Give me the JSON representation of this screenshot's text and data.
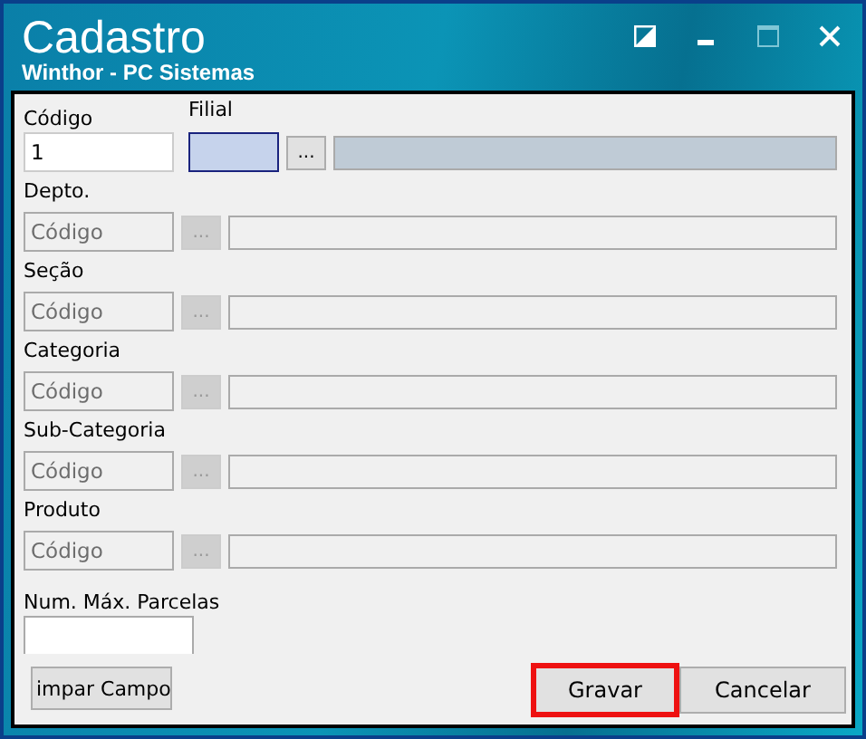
{
  "window": {
    "title": "Cadastro",
    "subtitle": "Winthor - PC Sistemas"
  },
  "codigo": {
    "label": "Código",
    "value": "1"
  },
  "filial": {
    "label": "Filial",
    "button": "...",
    "focused": true
  },
  "lookups": [
    {
      "label": "Depto.",
      "placeholder": "Código",
      "button": "...",
      "disabled": true
    },
    {
      "label": "Seção",
      "placeholder": "Código",
      "button": "...",
      "disabled": true
    },
    {
      "label": "Categoria",
      "placeholder": "Código",
      "button": "...",
      "disabled": true
    },
    {
      "label": "Sub-Categoria",
      "placeholder": "Código",
      "button": "...",
      "disabled": true
    },
    {
      "label": "Produto",
      "placeholder": "Código",
      "button": "...",
      "disabled": true
    }
  ],
  "parcelas": {
    "label": "Num. Máx. Parcelas"
  },
  "buttons": [
    {
      "label": "impar Campo",
      "kind": "clear",
      "highlighted": false
    },
    {
      "label": "Gravar",
      "kind": "save",
      "highlighted": true
    },
    {
      "label": "Cancelar",
      "kind": "cancel",
      "highlighted": false
    }
  ]
}
